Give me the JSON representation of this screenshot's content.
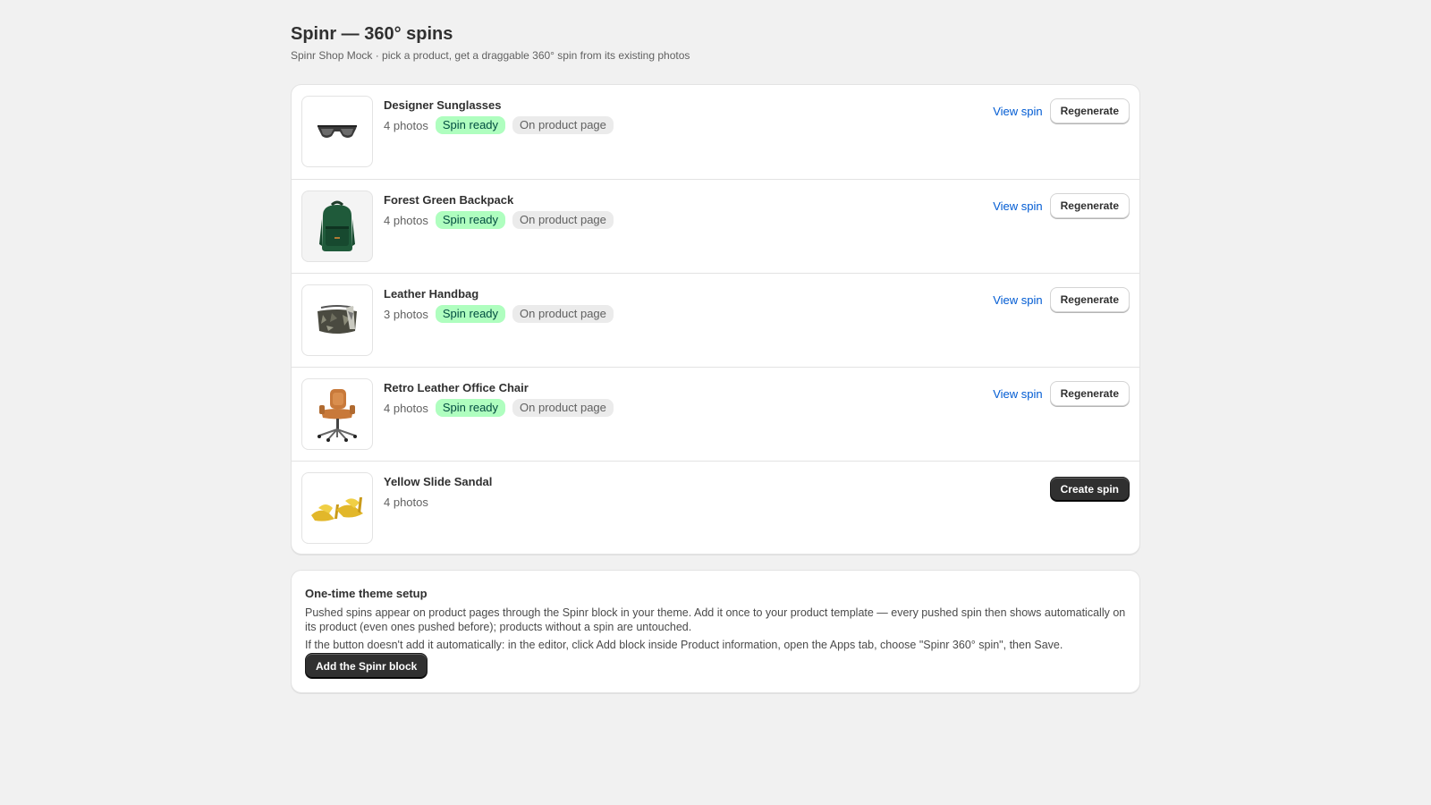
{
  "header": {
    "title": "Spinr — 360° spins",
    "subtitle": "Spinr Shop Mock · pick a product, get a draggable 360° spin from its existing photos"
  },
  "labels": {
    "spin_ready": "Spin ready",
    "on_product_page": "On product page",
    "view_spin": "View spin",
    "regenerate": "Regenerate",
    "create_spin": "Create spin"
  },
  "products": [
    {
      "name": "Designer Sunglasses",
      "photos": "4 photos",
      "thumb_icon": "sunglasses-icon",
      "has_spin": true
    },
    {
      "name": "Forest Green Backpack",
      "photos": "4 photos",
      "thumb_icon": "backpack-icon",
      "has_spin": true
    },
    {
      "name": "Leather Handbag",
      "photos": "3 photos",
      "thumb_icon": "handbag-icon",
      "has_spin": true
    },
    {
      "name": "Retro Leather Office Chair",
      "photos": "4 photos",
      "thumb_icon": "office-chair-icon",
      "has_spin": true
    },
    {
      "name": "Yellow Slide Sandal",
      "photos": "4 photos",
      "thumb_icon": "sandal-icon",
      "has_spin": false
    }
  ],
  "setup": {
    "title": "One-time theme setup",
    "text1": "Pushed spins appear on product pages through the Spinr block in your theme. Add it once to your product template — every pushed spin then shows automatically on its product (even ones pushed before); products without a spin are untouched.",
    "text2": "If the button doesn't add it automatically: in the editor, click Add block inside Product information, open the Apps tab, choose \"Spinr 360° spin\", then Save.",
    "button": "Add the Spinr block"
  },
  "colors": {
    "page_bg": "#f1f1f1",
    "link": "#005bd3",
    "badge_ready_bg": "#affebf",
    "badge_ready_text": "#014b40",
    "primary_button": "#303030"
  }
}
